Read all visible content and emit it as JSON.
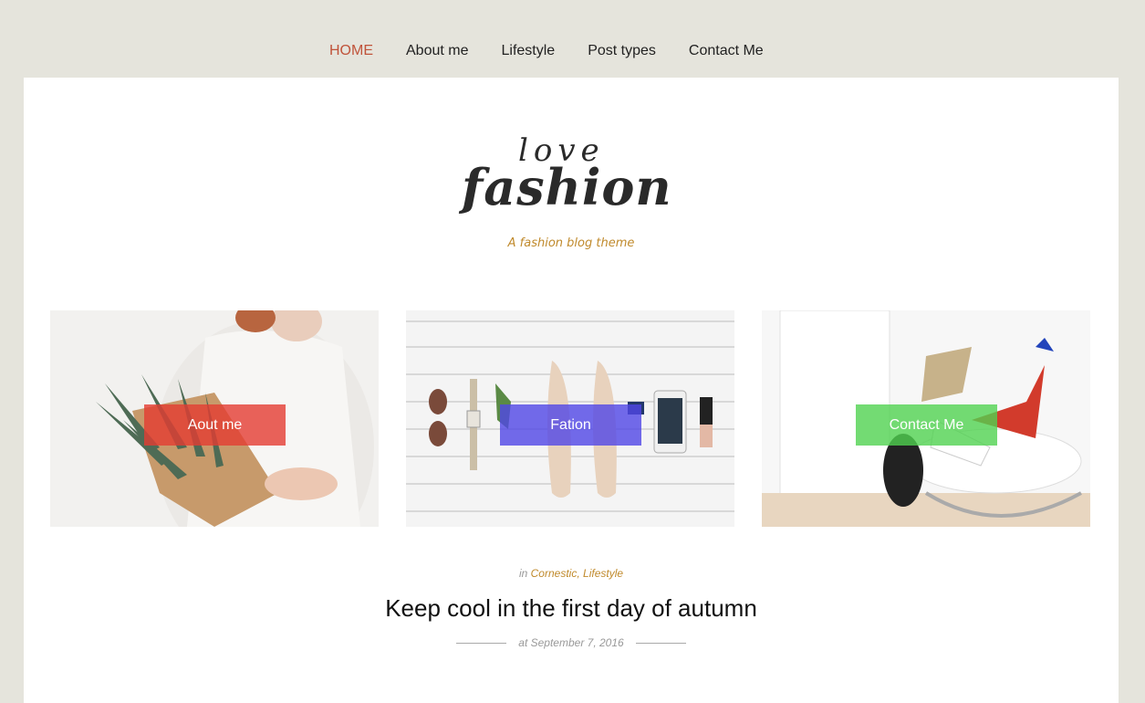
{
  "nav": {
    "items": [
      {
        "label": "HOME",
        "active": true
      },
      {
        "label": "About me",
        "active": false
      },
      {
        "label": "Lifestyle",
        "active": false
      },
      {
        "label": "Post types",
        "active": false
      },
      {
        "label": "Contact Me",
        "active": false
      }
    ]
  },
  "header": {
    "logo_top": "love",
    "logo_main": "fashion",
    "tagline": "A fashion blog theme"
  },
  "cards": [
    {
      "label": "Aout me",
      "color": "#e35a4f"
    },
    {
      "label": "Fation",
      "color": "#6a5cf0"
    },
    {
      "label": "Contact Me",
      "color": "#6fe06f"
    }
  ],
  "post": {
    "category_prefix": "in",
    "categories": [
      "Cornestic",
      "Lifestyle"
    ],
    "category_sep": ",",
    "title": "Keep cool in the first day of autumn",
    "date": "at September 7, 2016"
  }
}
